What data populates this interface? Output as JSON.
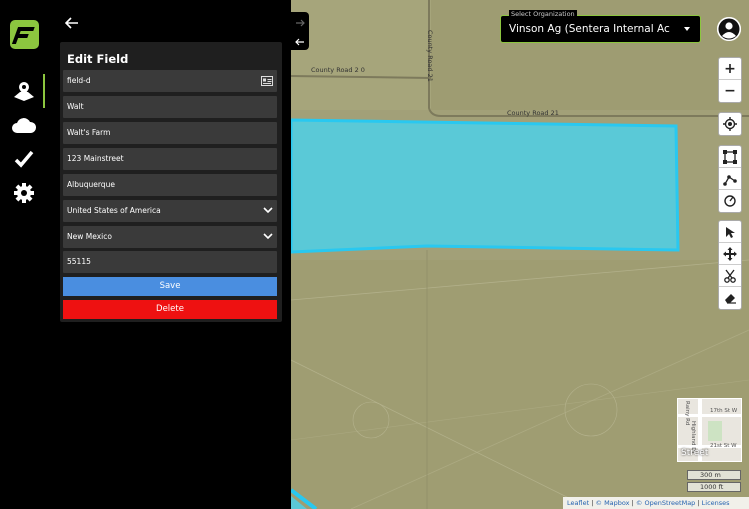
{
  "sidebar": {
    "items": [
      {
        "name": "fields-map-icon",
        "active": true
      },
      {
        "name": "cloud-icon",
        "active": false
      },
      {
        "name": "check-icon",
        "active": false
      },
      {
        "name": "settings-gear-icon",
        "active": false
      }
    ]
  },
  "panel": {
    "title": "Edit Field",
    "fields": {
      "field_name": "field-d",
      "owner": "Walt",
      "farm": "Walt's Farm",
      "street": "123 Mainstreet",
      "city": "Albuquerque",
      "country": "United States of America",
      "state": "New Mexico",
      "zip": "55115"
    },
    "save_label": "Save",
    "delete_label": "Delete"
  },
  "map": {
    "org_label": "Select Organization",
    "org_value": "Vinson Ag (Sentera Internal Ac",
    "roads": {
      "county_road_20": "County Road 2 0",
      "county_road_21_h": "County Road 21",
      "county_road_21_v": "County Road 21"
    },
    "field_polygon_color": "#4dd0e8",
    "minimap": {
      "label": "Street",
      "streets": [
        "17th St W",
        "21st St W",
        "Highland Dr",
        "Rainy Rd"
      ]
    },
    "scale": {
      "metric": "300 m",
      "imperial": "1000 ft"
    },
    "attribution": {
      "leaflet": "Leaflet",
      "sep1": "|",
      "mapbox": "© Mapbox",
      "sep2": "|",
      "osm": "© OpenStreetMap",
      "sep3": "|",
      "licenses": "Licenses"
    }
  },
  "colors": {
    "accent": "#8cc63f",
    "save": "#4a8ee0",
    "delete": "#ee1111"
  }
}
